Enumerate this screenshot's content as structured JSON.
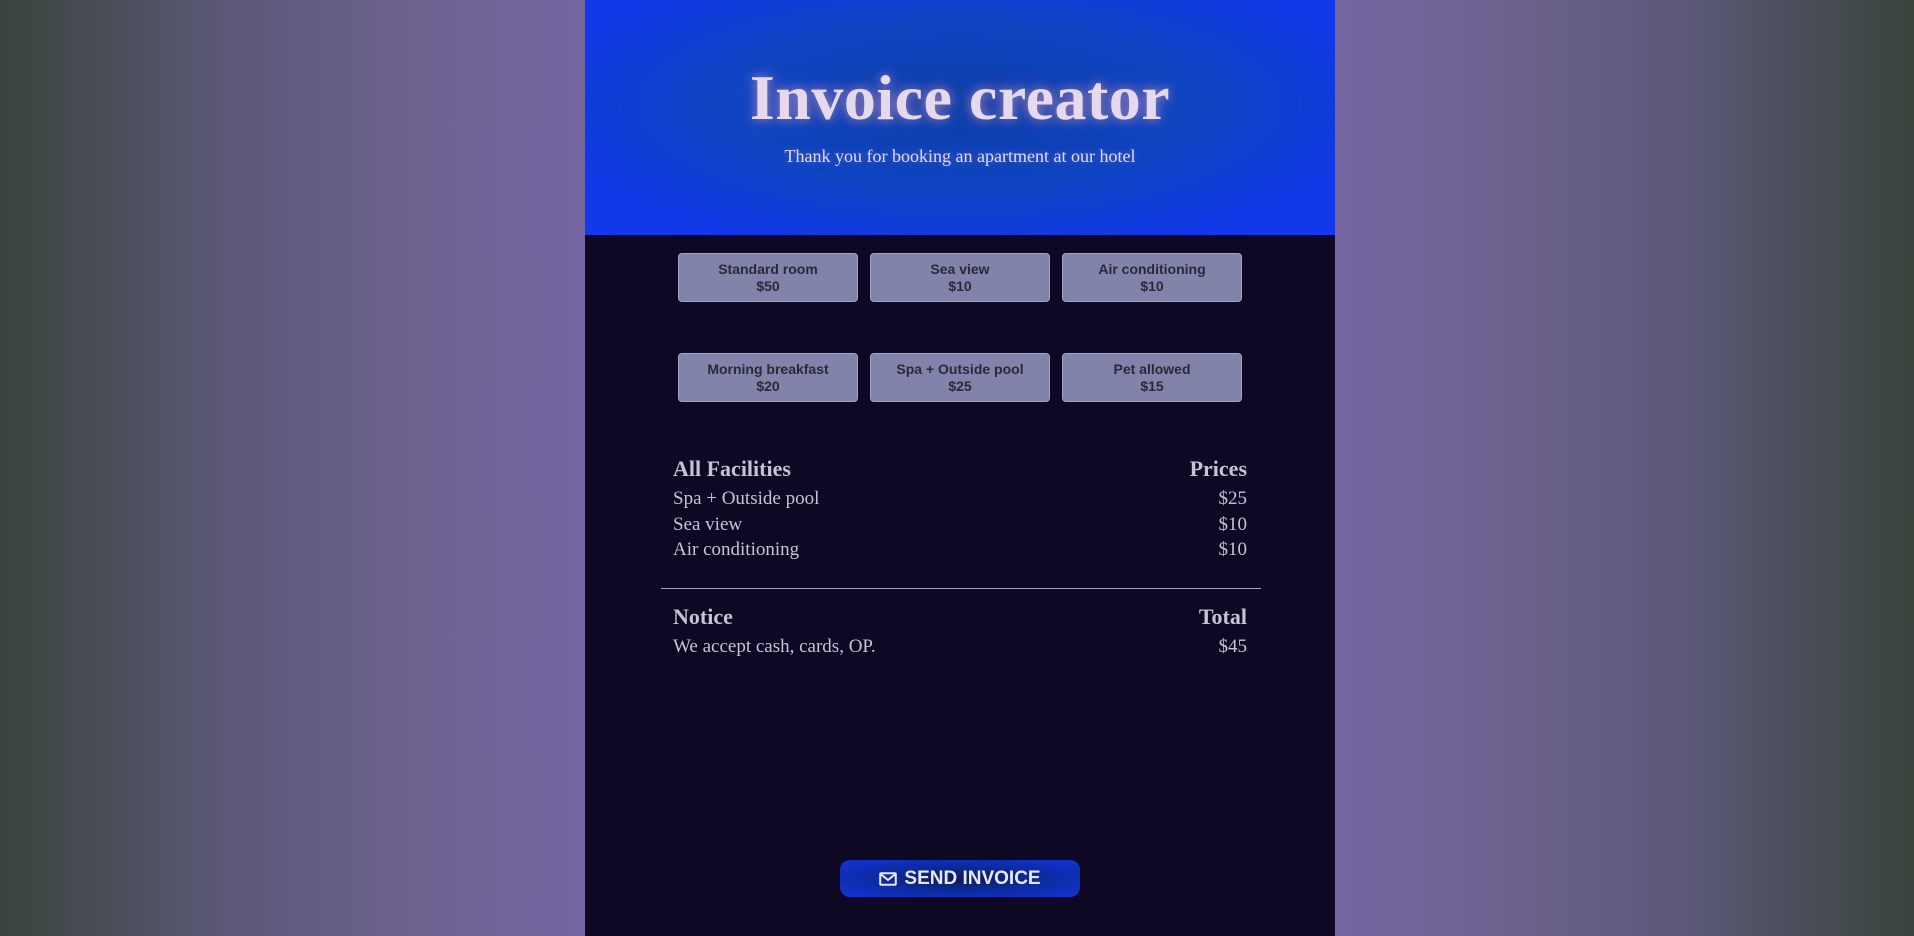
{
  "header": {
    "title": "Invoice creator",
    "subtitle": "Thank you for booking an apartment at our hotel"
  },
  "options": [
    {
      "label": "Standard room",
      "price": "$50"
    },
    {
      "label": "Sea view",
      "price": "$10"
    },
    {
      "label": "Air conditioning",
      "price": "$10"
    },
    {
      "label": "Morning breakfast",
      "price": "$20"
    },
    {
      "label": "Spa + Outside pool",
      "price": "$25"
    },
    {
      "label": "Pet allowed",
      "price": "$15"
    }
  ],
  "facilities": {
    "heading_left": "All Facilities",
    "heading_right": "Prices",
    "items": [
      {
        "name": "Spa + Outside pool",
        "price": "$25"
      },
      {
        "name": "Sea view",
        "price": "$10"
      },
      {
        "name": "Air conditioning",
        "price": "$10"
      }
    ]
  },
  "summary": {
    "notice_heading": "Notice",
    "total_heading": "Total",
    "notice_text": "We accept cash, cards, OP.",
    "total_value": "$45"
  },
  "send_button": {
    "label": "SEND INVOICE",
    "icon": "mail-icon"
  }
}
